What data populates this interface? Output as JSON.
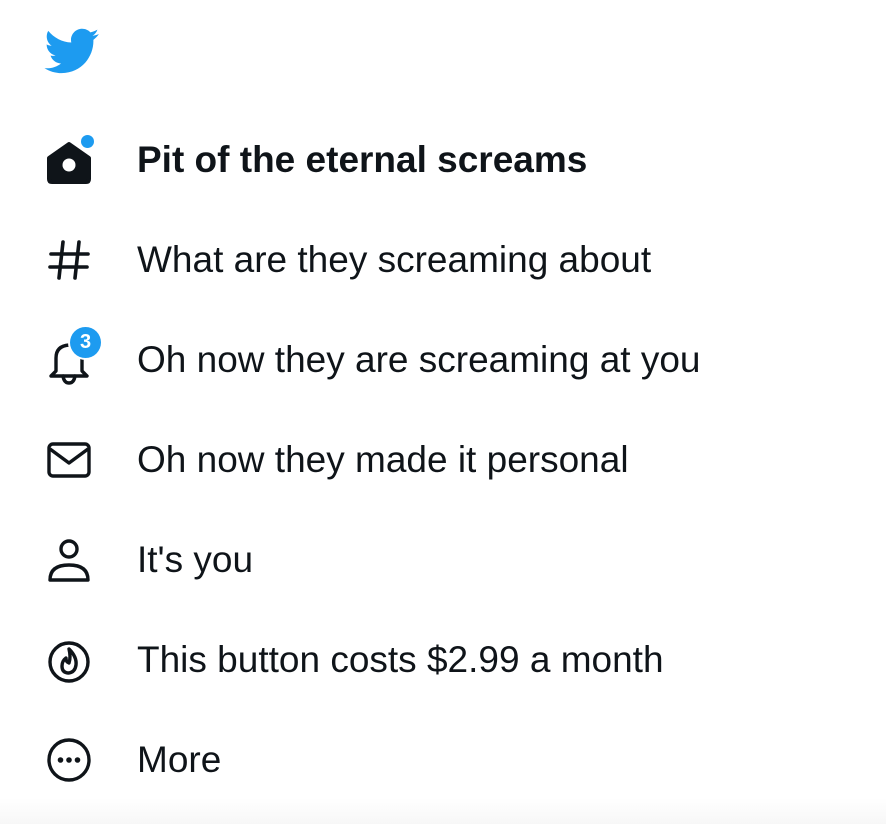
{
  "brand": {
    "logo_icon": "twitter-bird-icon",
    "accent_color": "#1d9bf0"
  },
  "nav": {
    "items": [
      {
        "label": "Pit of the eternal screams",
        "icon": "home-icon",
        "active": true,
        "has_dot": true
      },
      {
        "label": "What are they screaming about",
        "icon": "hashtag-icon"
      },
      {
        "label": "Oh now they are screaming at you",
        "icon": "bell-icon",
        "badge": "3"
      },
      {
        "label": "Oh now they made it personal",
        "icon": "envelope-icon"
      },
      {
        "label": "It's you",
        "icon": "profile-icon"
      },
      {
        "label": "This button costs $2.99 a month",
        "icon": "flame-icon"
      },
      {
        "label": "More",
        "icon": "more-circle-icon"
      }
    ]
  }
}
